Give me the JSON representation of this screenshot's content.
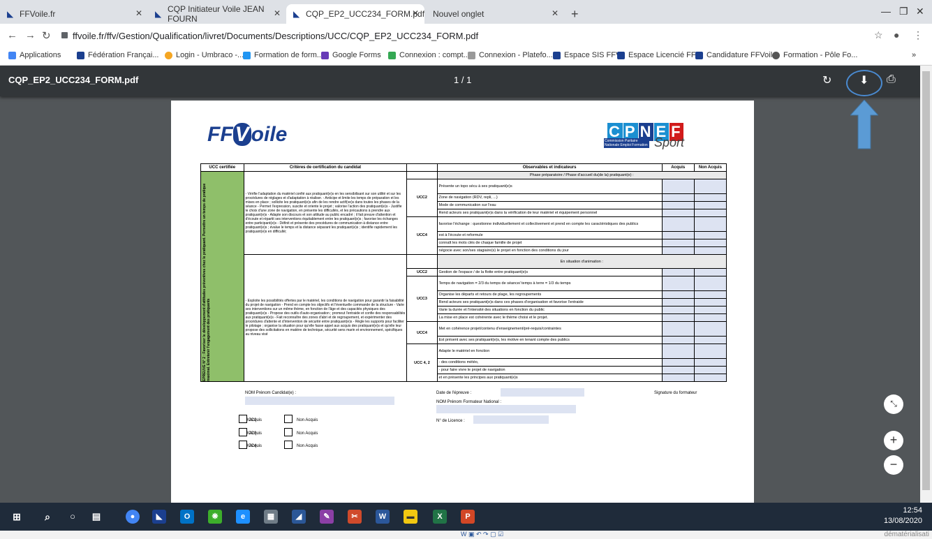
{
  "tabs": [
    {
      "title": "FFVoile.fr"
    },
    {
      "title": "CQP Initiateur Voile JEAN FOURN"
    },
    {
      "title": "CQP_EP2_UCC234_FORM.pdf"
    },
    {
      "title": "Nouvel onglet"
    }
  ],
  "address": {
    "url": "ffvoile.fr/ffv/Gestion/Qualification/livret/Documents/Descriptions/UCC/CQP_EP2_UCC234_FORM.pdf"
  },
  "bookmarks": [
    "Applications",
    "Fédération Françai...",
    "Login - Umbraco -...",
    "Formation de form...",
    "Google Forms",
    "Connexion : compt...",
    "Connexion - Platefo...",
    "Espace SIS FFV",
    "Espace Licencié FFV",
    "Candidature FFVoile",
    "Formation - Pôle Fo..."
  ],
  "viewer": {
    "filename": "CQP_EP2_UCC234_FORM.pdf",
    "page_indicator": "1 / 1"
  },
  "doc": {
    "logo_left": "FF Voile",
    "logo_right": "CPNEF",
    "logo_sub": "Commission Paritaire Nationale Emploi Formation",
    "logo_sport": "Sport",
    "headers": [
      "UCC certifiée",
      "Critères de certification du candidat",
      "",
      "Observables et indicateurs",
      "Acquis",
      "Non Acquis"
    ],
    "vertical_label": "EPREUVE N° 2 : Favoriser le développement d'attitudes préventives chez le pratiquant. Permettre un temps de pratique maximal. Entretenir l'engagement des pratiquants",
    "criteria_top": "- Vérifie l'adaptation du matériel confié aux pratiquant(e)s en les sensibilisant sur son utilité et sur les procédures de réglages et d'adaptation à réaliser. - Anticipe et limite les temps de préparation et les mises en place ; sollicite les pratiquant(e)s afin de les rendre actif(ve)s dans toutes les phases de la séance - Permet l'expression, suscite et oriente le projet ; valorise l'action des pratiquant(e)s - Justifie le choix d'une zone de navigation, en présente les difficultés, et les précautions à prendre aux pratiquant(e)s - Adapte son discours et son attitude au public encadré ; il fait preuve d'attention et d'écoute et répartit ses interventions équitablement entre les pratiquant(e)s ; favorise les échanges entre participant(e)s - Définit et présente des procédures de communication à distance entre pratiquant(e)s ; évalue le temps et la distance séparant les pratiquant(e)s ; identifie rapidement les pratiquant(e)s en difficulté;",
    "criteria_bottom": "- Exploite les possibilités offertes par le matériel, les conditions de navigation pour garantir la faisabilité du projet de navigation - Prend en compte les objectifs et l'éventuelle commande de la structure - Varie ses interventions sur un même thème, en fonction de l'âge et des capacités physiques des pratiquant(e)s - Propose des outils d'auto-organisation ; promeut l'entraide et confie des responsabilités aux pratiquant(e)s - Fait reconnaître des zones d'abri et de regroupement, et expérimenter des procédures d'attente et d'intervention de sécurité entre pratiquant(e)s - Règle les supports pour faciliter le pilotage ; organise la situation pour qu'elle fasse appel aux acquis des pratiquant(e)s et qu'elle leur propose des sollicitations en matière de technique, sécurité sens marin et environnement, spécifiques au niveau visé",
    "phase1": "Phase préparatoire / Phase d'accueil du(de la) pratiquant(e) :",
    "phase2": "En situation d'animation :",
    "groups": [
      {
        "ucc": "UCC2",
        "rows": [
          "Présente un topo sécu à ses pratiquant(e)s",
          "Zone de navigation (RDV, repli, ...)",
          "Mode de communication sur l'eau",
          "Rend acteurs ses pratiquant(e)s dans la vérification de leur matériel et équipement personnel"
        ]
      },
      {
        "ucc": "UCC4",
        "rows": [
          "favorise l'échange : questionne individuellement et collectivement et prend en compte les caractéristiques des publics",
          "est à l'écoute et reformule",
          "connaît les mots clés de chaque famille de projet",
          "négocie avec son/ses stagiaire(s) le projet en fonction des conditions du jour"
        ]
      },
      {
        "ucc": "UCC2",
        "rows": [
          "Gestion de l'espace / de la flotte entre pratiquant(e)s"
        ]
      },
      {
        "ucc": "UCC3",
        "rows": [
          "Temps de navigation = 2/3 du temps de séance/ temps à terre = 1/3 du temps",
          "Organise les départs et retours de plage, les regroupements",
          "Rend acteurs ses pratiquant(e)s dans ces phases d'organisation et favorise l'entraide",
          "Varie la durée et l'intensité des situations en fonction du public",
          "La mise en place est cohérente avec le thème choisi et le projet."
        ]
      },
      {
        "ucc": "UCC4",
        "rows": [
          "Met en cohérence projet/contenu d'enseignement/pré-requis/contraintes",
          "Est présent avec ses pratiquant(e)s, les motive en tenant compte des publics"
        ]
      },
      {
        "ucc": "UCC 4, 2",
        "rows": [
          "Adapte le matériel en fonction",
          "- des conditions météo,",
          "- pour faire vivre le projet de navigation",
          "et en présente les principes aux pratiquant(e)s"
        ]
      }
    ],
    "footer": {
      "nom": "NOM Prénom Candidat(e) :",
      "date": "Date de l'épreuve :",
      "signature": "Signature du formateur",
      "formateur": "NOM Prénom Formateur National :",
      "licence": "N° de Licence :",
      "ucc": [
        "UCC2 :",
        "UCC3 :",
        "UCC4 :"
      ],
      "acquis": "Acquis",
      "non_acquis": "Non Acquis"
    }
  },
  "taskbar": {
    "time": "12:54",
    "date": "13/08/2020"
  },
  "bottom_text": "dématérialisati"
}
